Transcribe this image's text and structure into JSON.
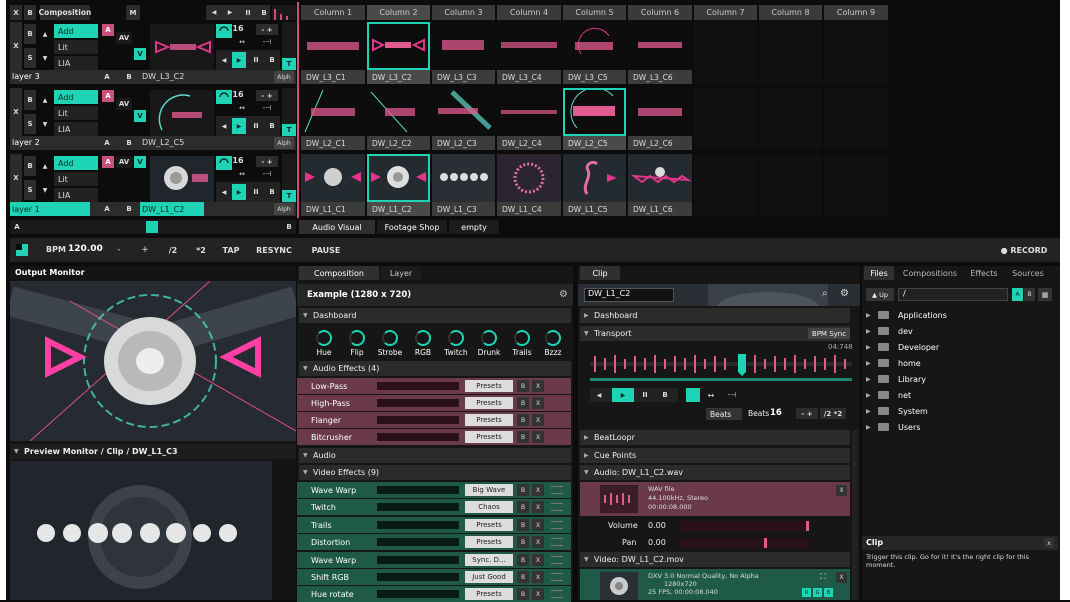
{
  "top": {
    "x": "X",
    "b": "B",
    "composition": "Composition",
    "m": "M",
    "pause": "II",
    "b2": "B"
  },
  "columns": [
    "Column 1",
    "Column 2",
    "Column 3",
    "Column 4",
    "Column 5",
    "Column 6",
    "Column 7",
    "Column 8",
    "Column 9"
  ],
  "layers": [
    {
      "name": "layer 3",
      "clip": "DW_L3_C2",
      "clips": [
        "DW_L3_C1",
        "DW_L3_C2",
        "DW_L3_C3",
        "DW_L3_C4",
        "DW_L3_C5",
        "DW_L3_C6"
      ],
      "num": "16"
    },
    {
      "name": "layer 2",
      "clip": "DW_L2_C5",
      "clips": [
        "DW_L2_C1",
        "DW_L2_C2",
        "DW_L2_C3",
        "DW_L2_C4",
        "DW_L2_C5",
        "DW_L2_C6"
      ],
      "num": "16"
    },
    {
      "name": "layer 1",
      "clip": "DW_L1_C2",
      "clips": [
        "DW_L1_C1",
        "DW_L1_C2",
        "DW_L1_C3",
        "DW_L1_C4",
        "DW_L1_C5",
        "DW_L1_C6"
      ],
      "num": "16"
    }
  ],
  "layerctl": {
    "x": "X",
    "b": "B",
    "s": "S",
    "add": "Add",
    "lit": "Lit",
    "lia": "LIA",
    "a": "A",
    "av": "AV",
    "v": "V",
    "alph": "Alph",
    "t": "T",
    "minus": "-",
    "plus": "+",
    "stop": "II",
    "bb": "B",
    "colA": "A",
    "colB": "B"
  },
  "decks": {
    "a": "A",
    "b": "B",
    "tabs": [
      "Audio Visual",
      "Footage Shop",
      "empty"
    ]
  },
  "transport": {
    "bpm_label": "BPM",
    "bpm": "120.00",
    "minus": "-",
    "plus": "+",
    "half": "/2",
    "double": "*2",
    "tap": "TAP",
    "resync": "RESYNC",
    "pause": "PAUSE",
    "record": "● RECORD"
  },
  "output": {
    "title": "Output Monitor",
    "preview": "Preview Monitor / Clip / DW_L1_C3"
  },
  "comp": {
    "tab1": "Composition",
    "tab2": "Layer",
    "name": "Example (1280 x 720)",
    "dashboard": "Dashboard",
    "knobs": [
      "Hue",
      "Flip",
      "Strobe",
      "RGB",
      "Twitch",
      "Drunk",
      "Trails",
      "Bzzz"
    ],
    "audio_effects": "Audio Effects (4)",
    "aeffects": [
      {
        "n": "Low-Pass",
        "p": "Presets"
      },
      {
        "n": "High-Pass",
        "p": "Presets"
      },
      {
        "n": "Flanger",
        "p": "Presets"
      },
      {
        "n": "Bitcrusher",
        "p": "Presets"
      }
    ],
    "audio": "Audio",
    "video_effects": "Video Effects (9)",
    "veffects": [
      {
        "n": "Wave Warp",
        "p": "Big Wave"
      },
      {
        "n": "Twitch",
        "p": "Chaos"
      },
      {
        "n": "Trails",
        "p": "Presets"
      },
      {
        "n": "Distortion",
        "p": "Presets"
      },
      {
        "n": "Wave Warp",
        "p": "Sync. D..."
      },
      {
        "n": "Shift RGB",
        "p": "Just Good"
      },
      {
        "n": "Hue rotate",
        "p": "Presets"
      }
    ],
    "b": "B",
    "x": "X"
  },
  "clip": {
    "tab": "Clip",
    "name": "DW_L1_C2",
    "dashboard": "Dashboard",
    "transport": "Transport",
    "bpm_sync": "BPM Sync",
    "time": "04:748",
    "beats_dd": "Beats",
    "beats_label": "Beats",
    "beats": "16",
    "minus": "-",
    "plus": "+",
    "half": "/2",
    "double": "*2",
    "beatloopr": "BeatLoopr",
    "cue": "Cue Points",
    "audio_title": "Audio: DW_L1_C2.wav",
    "wav1": "WAV file",
    "wav2": "44.100kHz, Stereo",
    "wav3": "00:00:08.000",
    "volume": "Volume",
    "volume_val": "0.00",
    "pan": "Pan",
    "pan_val": "0.00",
    "video_title": "Video: DW_L1_C2.mov",
    "vid1": "DXV 3.0 Normal Quality, No Alpha",
    "vid2": "1280x720",
    "vid3": "25 FPS, 00:00:08.040",
    "x": "X",
    "rgb": [
      "R",
      "G",
      "B"
    ]
  },
  "files": {
    "tabs": [
      "Files",
      "Compositions",
      "Effects",
      "Sources"
    ],
    "up": "▲ Up",
    "path": "/",
    "ab": "A",
    "bb": "B",
    "items": [
      "Applications",
      "dev",
      "Developer",
      "home",
      "Library",
      "net",
      "System",
      "Users"
    ],
    "clip_title": "Clip",
    "clip_desc": "Trigger this clip. Go for it! It's the right clip for this moment."
  }
}
